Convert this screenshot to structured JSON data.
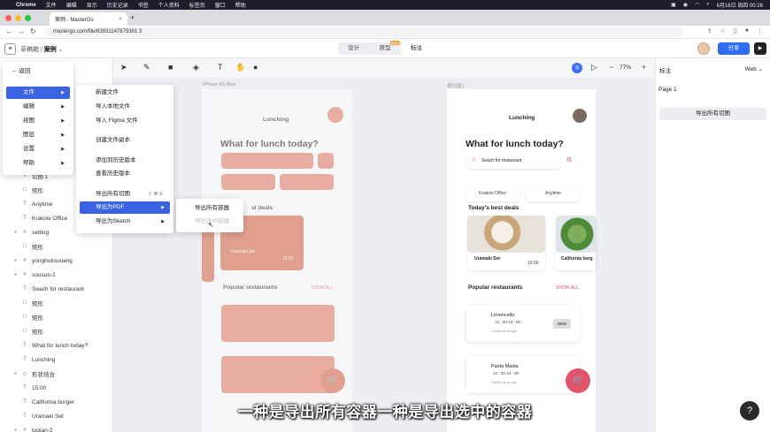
{
  "macbar": {
    "app": "Chrome",
    "items": [
      "文件",
      "编辑",
      "显示",
      "历史记录",
      "书签",
      "个人资料",
      "标签页",
      "窗口",
      "帮助"
    ],
    "datetime": "6月16日 周四 00:26"
  },
  "browser": {
    "tab_title": "案例 - MasterGo",
    "url": "mastergo.com/file/63931147879381 3"
  },
  "app": {
    "team": "草稿箱",
    "file": "案例",
    "modes": [
      "设计",
      "原型",
      "标注"
    ],
    "mode_badge": "Beta",
    "share": "分享"
  },
  "toolbar": {
    "zoom": "77%"
  },
  "layers": [
    {
      "label": "切图 1",
      "expand": false,
      "icon": "frame"
    },
    {
      "label": "矩形",
      "expand": false,
      "icon": "rect"
    },
    {
      "label": "Anytime",
      "expand": false,
      "icon": "text"
    },
    {
      "label": "Krakow Office",
      "expand": false,
      "icon": "text"
    },
    {
      "label": "setting",
      "expand": true,
      "icon": "frame"
    },
    {
      "label": "矩形",
      "expand": false,
      "icon": "rect"
    },
    {
      "label": "yonghutouxiang",
      "expand": true,
      "icon": "frame"
    },
    {
      "label": "sousuo-2",
      "expand": true,
      "icon": "frame"
    },
    {
      "label": "Seach for restaurant",
      "expand": false,
      "icon": "text"
    },
    {
      "label": "矩形",
      "expand": false,
      "icon": "rect"
    },
    {
      "label": "矩形",
      "expand": false,
      "icon": "rect"
    },
    {
      "label": "矩形",
      "expand": false,
      "icon": "rect"
    },
    {
      "label": "What for lunch today?",
      "expand": false,
      "icon": "text"
    },
    {
      "label": "Lunching",
      "expand": false,
      "icon": "text"
    },
    {
      "label": "形状结合",
      "expand": true,
      "icon": "shape"
    },
    {
      "label": "15:00",
      "expand": false,
      "icon": "text"
    },
    {
      "label": "California burger",
      "expand": false,
      "icon": "text"
    },
    {
      "label": "Uramaki Set",
      "expand": false,
      "icon": "text"
    },
    {
      "label": "tupian-2",
      "expand": true,
      "icon": "frame"
    }
  ],
  "menu_main": {
    "back": "返回",
    "items": [
      "文件",
      "编辑",
      "视图",
      "图层",
      "设置",
      "帮助"
    ]
  },
  "menu_file": {
    "items": [
      "新建文件",
      "导入本地文件",
      "导入 Figma 文件",
      "创建文件副本",
      "添加到历史版本",
      "查看历史版本",
      "导出所有切图",
      "导出为PDF",
      "导出为Sketch"
    ],
    "export_shortcut": "⇧ ⌘ E"
  },
  "menu_pdf": {
    "items": [
      "导出所有容器",
      "导出选中容器"
    ]
  },
  "canvas": {
    "frame1_label": "iPhone 8S Max",
    "frame2_label": "裁切版1",
    "phone": {
      "title": "Lunching",
      "headline": "What for lunch today?",
      "search": "Seach for restaurant",
      "chip1": "Krakow Office",
      "chip2": "Anytime",
      "best": "Today's best deals",
      "best_partial": "st deals",
      "deal1": "Uramaki Set",
      "deal1_sub": "California burger",
      "deal1_time": "15:00",
      "deal2": "California burg",
      "popular": "Popular restaurants",
      "showall": "SHOW ALL",
      "r1": "Limoncello",
      "r1_time": "12 : 30-13 : 00",
      "r1_sub": "California burger",
      "r1_badge": "NEW",
      "r2": "Pasta Masta",
      "r2_time": "12 : 30-13 : 00",
      "r2_sub": "California burger"
    }
  },
  "rpanel": {
    "title": "标注",
    "platform": "Web",
    "page": "Page 1",
    "export": "导出所有切图"
  },
  "subtitle": "一种是导出所有容器一种是导出选中的容器",
  "help": "?",
  "colors": {
    "accent": "#2f6df5",
    "coral": "#e8775f",
    "pink": "#e0556a",
    "menu_highlight": "#3b62e0"
  }
}
